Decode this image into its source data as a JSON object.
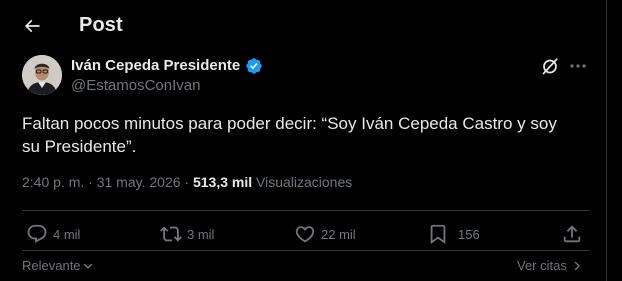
{
  "header": {
    "back_icon": "arrow-left-icon",
    "title": "Post"
  },
  "author": {
    "name": "Iván Cepeda Presidente",
    "handle": "@EstamosConIvan",
    "verified_icon": "verified-badge-icon",
    "verified_color": "#1d9bf0"
  },
  "top_actions": {
    "grok_icon": "grok-icon",
    "more_icon": "more-horizontal-icon"
  },
  "tweet": {
    "line1": "Faltan pocos minutos para poder decir: “Soy Iván Cepeda Castro y soy",
    "line2": "su Presidente”."
  },
  "meta": {
    "time": "2:40 p. m.",
    "separator": " · ",
    "date": "31 may. 2026",
    "separator2": " · ",
    "views_count": "513,3 mil",
    "views_label": " Visualizaciones"
  },
  "actions": {
    "reply": {
      "icon": "reply-icon",
      "count": "4 mil"
    },
    "repost": {
      "icon": "repost-icon",
      "count": "3 mil"
    },
    "like": {
      "icon": "heart-icon",
      "count": "22 mil"
    },
    "bookmark": {
      "icon": "bookmark-icon",
      "count": "156"
    },
    "share": {
      "icon": "share-icon"
    }
  },
  "footer": {
    "sort_label": "Relevante",
    "sort_icon": "chevron-down-icon",
    "quotes_label": "Ver citas",
    "quotes_icon": "chevron-right-icon"
  },
  "colors": {
    "background": "#000000",
    "text_primary": "#e7e9ea",
    "text_secondary": "#71767b",
    "border": "#2f3336",
    "accent": "#1d9bf0"
  }
}
